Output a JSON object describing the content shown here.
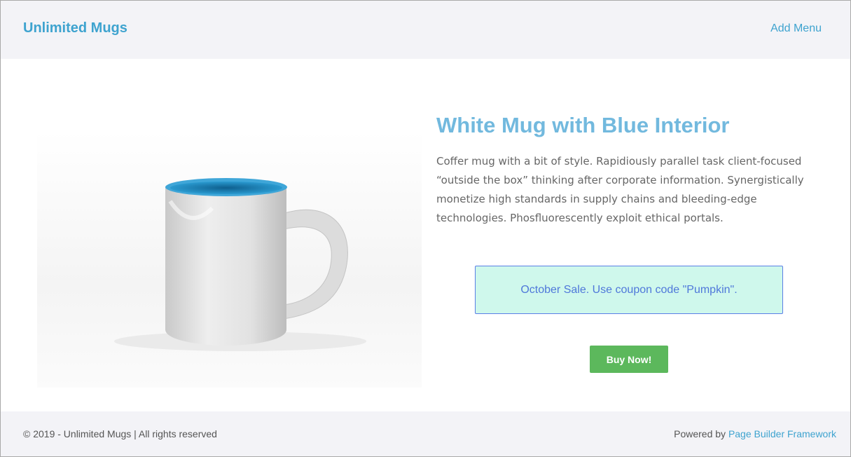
{
  "header": {
    "site_title": "Unlimited Mugs",
    "menu_link": "Add Menu"
  },
  "product": {
    "title": "White Mug with Blue Interior",
    "description": "Coffer mug with a bit of style. Rapidiously parallel task client-focused “outside the box” thinking after corporate information. Synergistically monetize high standards in supply chains and bleeding-edge technologies. Phosfluorescently exploit ethical portals.",
    "image_icon": "white-mug-with-blue-interior",
    "sale_text": "October Sale. Use coupon code \"Pumpkin\".",
    "buy_label": "Buy Now!"
  },
  "footer": {
    "copyright": "© 2019 - Unlimited Mugs | All rights reserved",
    "powered_prefix": "Powered by ",
    "powered_link": "Page Builder Framework"
  },
  "colors": {
    "brand": "#3ea3cf",
    "title": "#72b9de",
    "sale_bg": "#cff8ec",
    "sale_border": "#5b7fe6",
    "button": "#5cb85c"
  }
}
